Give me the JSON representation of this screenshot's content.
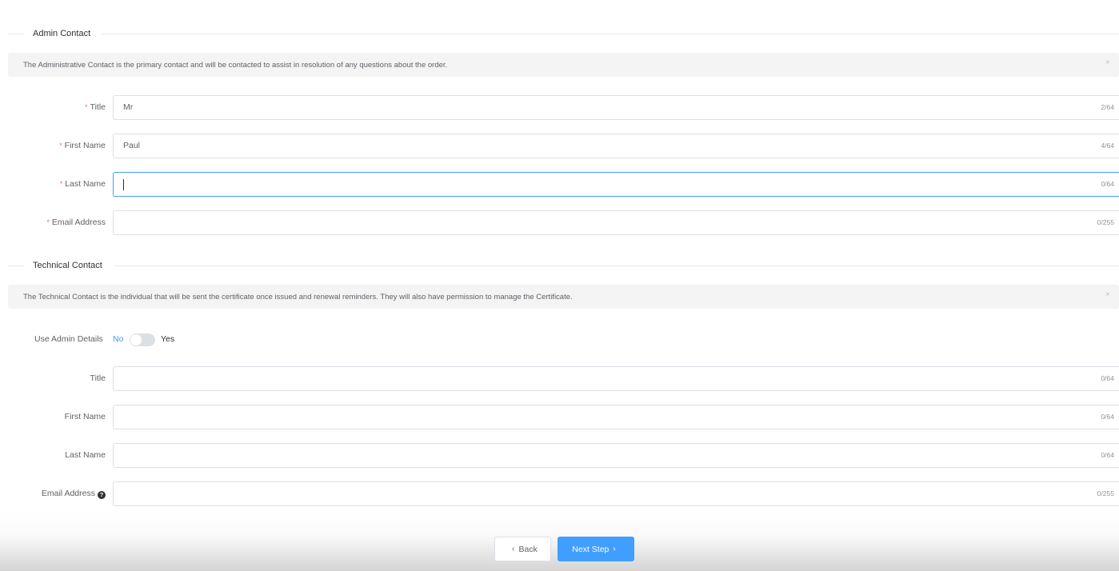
{
  "admin_section": {
    "title": "Admin Contact",
    "alert_text": "The Administrative Contact is the primary contact and will be contacted to assist in resolution of any questions about the order.",
    "close_icon": "×",
    "fields": [
      {
        "label": "Title",
        "required_mark": "*",
        "value": "Mr",
        "count": "2/64",
        "focused": false
      },
      {
        "label": "First Name",
        "required_mark": "*",
        "value": "Paul",
        "count": "4/64",
        "focused": false
      },
      {
        "label": "Last Name",
        "required_mark": "*",
        "value": "",
        "count": "0/64",
        "focused": true
      },
      {
        "label": "Email Address",
        "required_mark": "*",
        "value": "",
        "count": "0/255",
        "focused": false
      }
    ]
  },
  "technical_section": {
    "title": "Technical Contact",
    "alert_text": "The Technical Contact is the individual that will be sent the certificate once issued and renewal reminders. They will also have permission to manage the Certificate.",
    "close_icon": "×",
    "use_admin": {
      "label": "Use Admin Details",
      "off_label": "No",
      "on_label": "Yes",
      "enabled": false
    },
    "fields": [
      {
        "label": "Title",
        "value": "",
        "count": "0/64"
      },
      {
        "label": "First Name",
        "value": "",
        "count": "0/64"
      },
      {
        "label": "Last Name",
        "value": "",
        "count": "0/64"
      },
      {
        "label": "Email Address",
        "value": "",
        "count": "0/255",
        "help_icon": "?"
      }
    ]
  },
  "footer": {
    "back_label": "Back",
    "back_icon": "‹",
    "next_label": "Next Step",
    "next_icon": "›"
  },
  "colors": {
    "primary": "#409eff",
    "required": "#f56c6c",
    "alert_bg": "#f4f4f5"
  }
}
